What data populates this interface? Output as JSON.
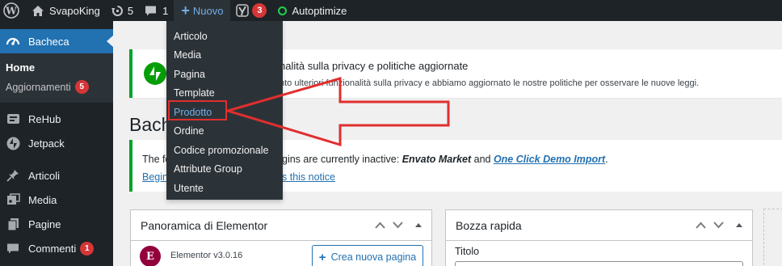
{
  "adminbar": {
    "site_name": "SvapoKing",
    "updates_count": "5",
    "comments_count": "1",
    "new_label": "Nuovo",
    "yoast_badge": "3",
    "autoptimize_label": "Autoptimize"
  },
  "new_menu": {
    "items": [
      {
        "label": "Articolo"
      },
      {
        "label": "Media"
      },
      {
        "label": "Pagina"
      },
      {
        "label": "Template"
      },
      {
        "label": "Prodotto"
      },
      {
        "label": "Ordine"
      },
      {
        "label": "Codice promozionale"
      },
      {
        "label": "Attribute Group"
      },
      {
        "label": "Utente"
      }
    ],
    "highlighted_color": "#72aee6",
    "annotation_color": "#e12e2e"
  },
  "sidebar": {
    "current": "Bacheca",
    "sub_home": "Home",
    "sub_updates": "Aggiornamenti",
    "sub_updates_badge": "5",
    "items": [
      {
        "label": "ReHub"
      },
      {
        "label": "Jetpack"
      },
      {
        "label": "Articoli"
      },
      {
        "label": "Media"
      },
      {
        "label": "Pagine"
      },
      {
        "label": "Commenti",
        "badge": "1"
      }
    ],
    "accent": "#2271b1"
  },
  "notice1": {
    "title": "nalità sulla privacy e politiche aggiornate",
    "text": "nto ulteriori funzionalità sulla privacy e abbiamo aggiornato le nostre politiche per osservare le nuove leggi."
  },
  "page": {
    "title": "Bache"
  },
  "notice2": {
    "text_left": "The fo",
    "text_right_pre": "gins are currently inactive: ",
    "plugin1": "Envato Market",
    "and": " and ",
    "plugin2": "One Click Demo Import",
    "dot": ".",
    "link_left": "Begin",
    "link_right": "s this notice"
  },
  "elementor_box": {
    "title": "Panoramica di Elementor",
    "icon_letter": "E",
    "version": "Elementor v3.0.16",
    "button": "Crea nuova pagina"
  },
  "quickdraft_box": {
    "title": "Bozza rapida",
    "field_label": "Titolo"
  }
}
